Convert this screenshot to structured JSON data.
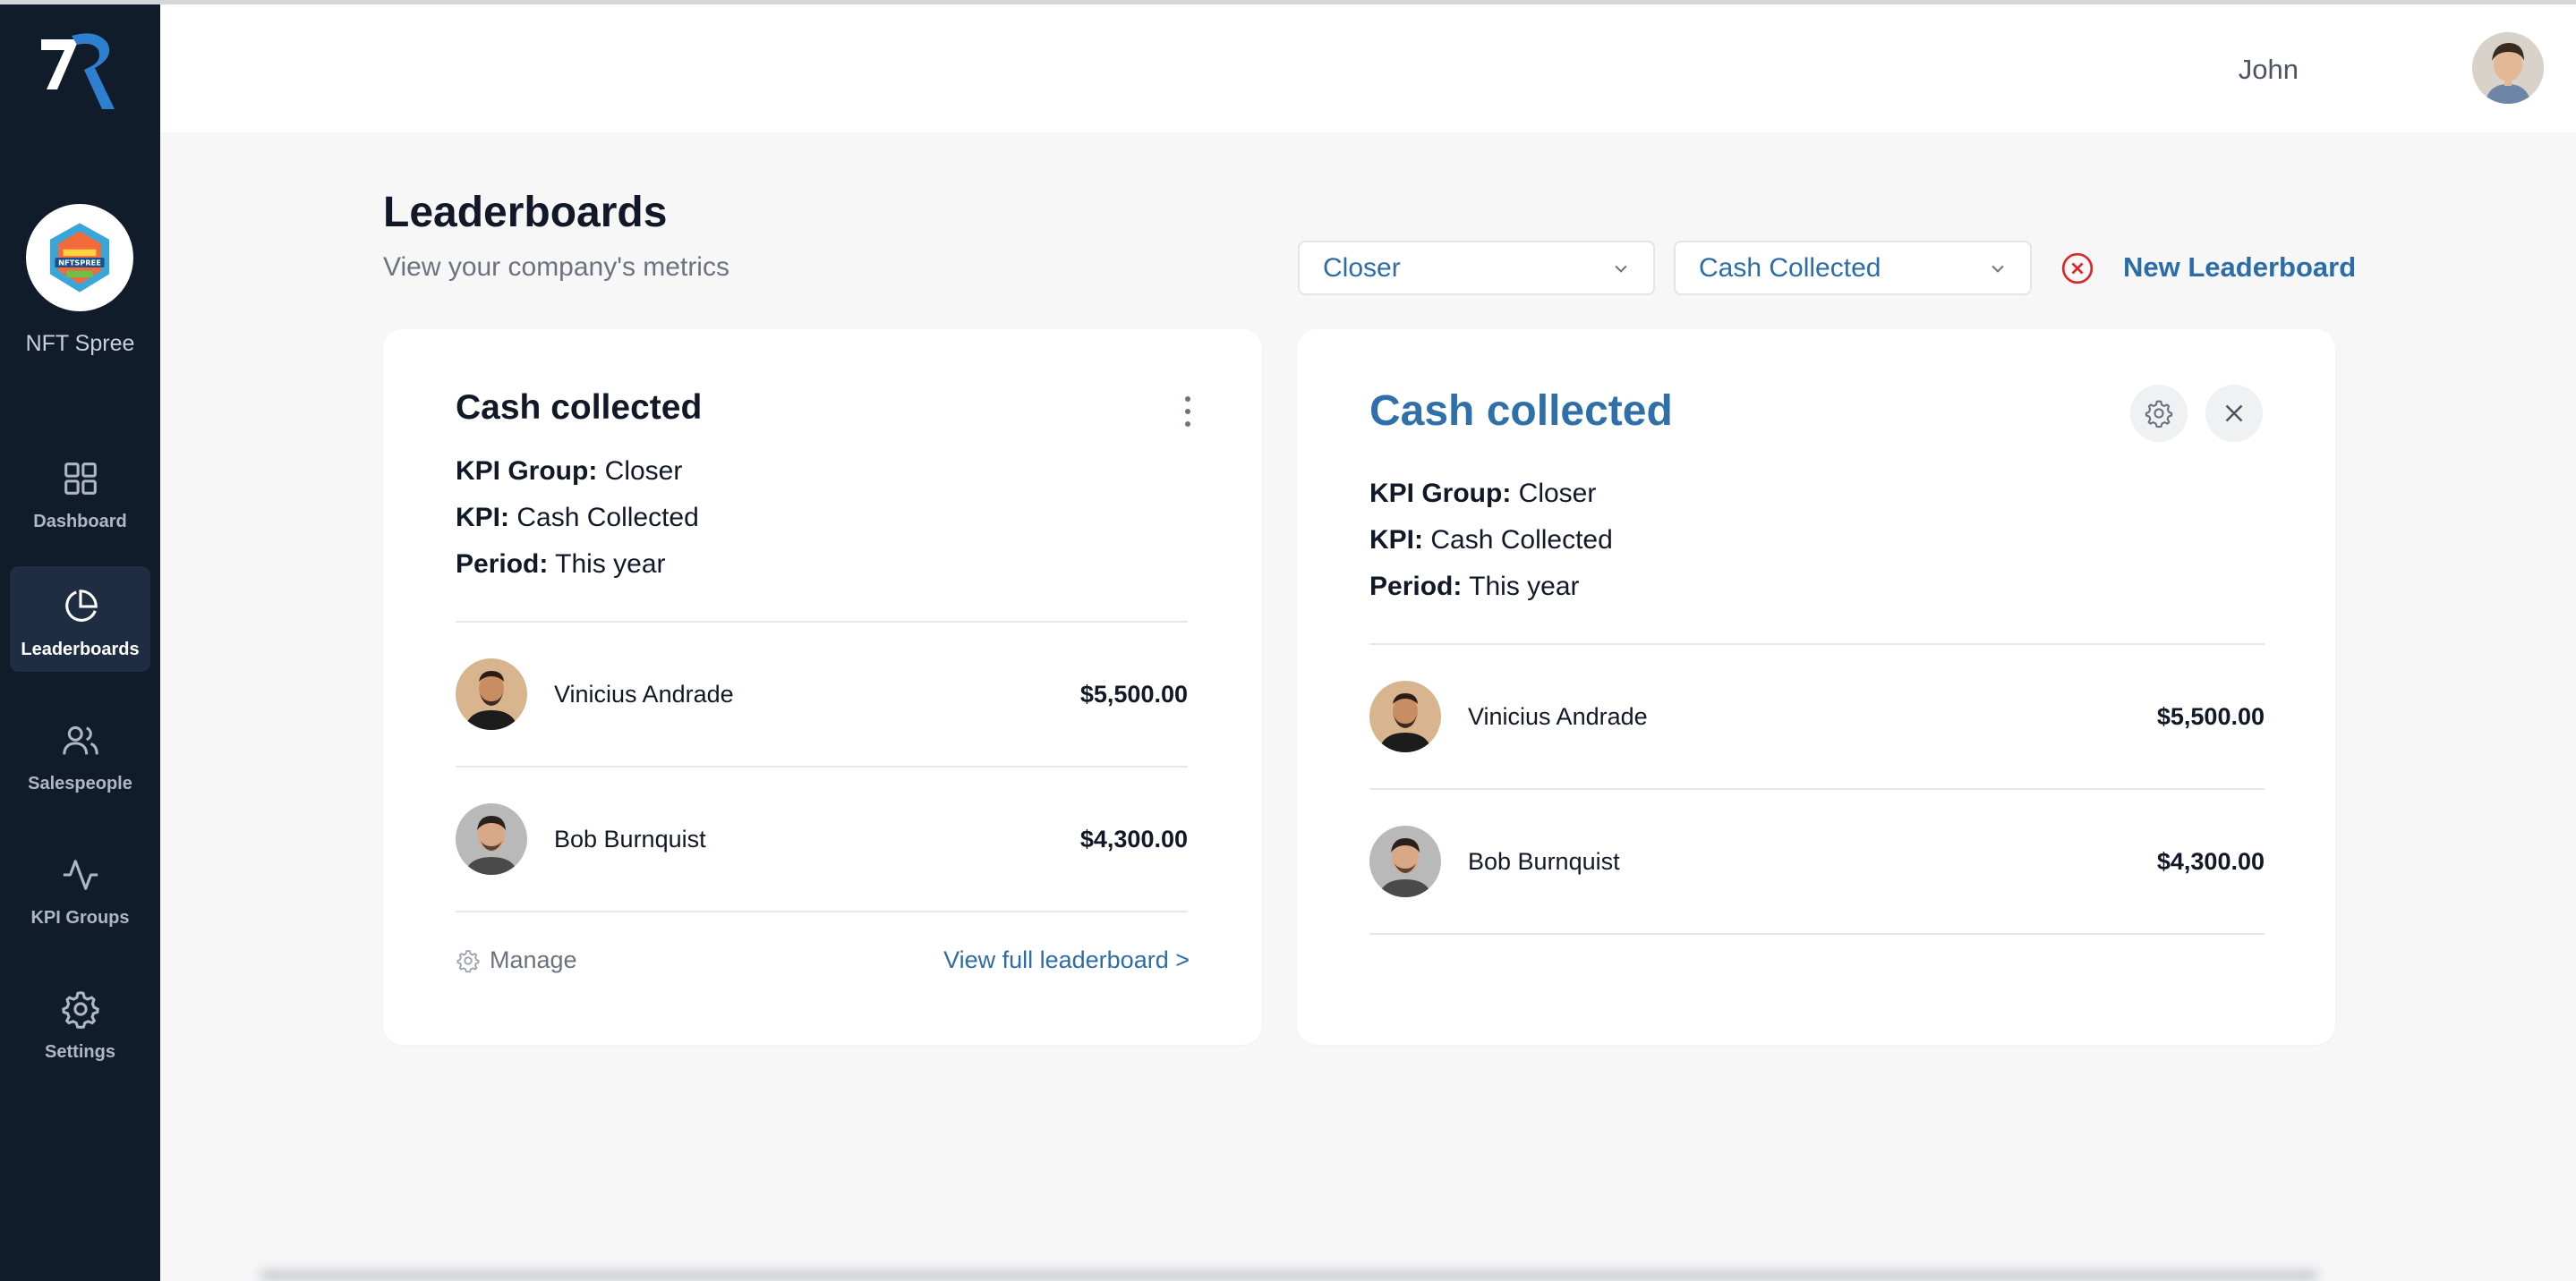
{
  "sidebar": {
    "company_name": "NFT Spree",
    "company_logo_text": "NFTSPREE",
    "items": [
      {
        "label": "Dashboard",
        "icon": "grid-icon"
      },
      {
        "label": "Leaderboards",
        "icon": "pie-chart-icon",
        "active": true
      },
      {
        "label": "Salespeople",
        "icon": "users-icon"
      },
      {
        "label": "KPI Groups",
        "icon": "activity-icon"
      },
      {
        "label": "Settings",
        "icon": "gear-icon"
      }
    ]
  },
  "header": {
    "user_name": "John"
  },
  "page": {
    "title": "Leaderboards",
    "subtitle": "View your company's metrics"
  },
  "filters": {
    "kpi_group": "Closer",
    "kpi": "Cash Collected",
    "new_label": "New Leaderboard"
  },
  "labels": {
    "kpi_group": "KPI Group:",
    "kpi": "KPI:",
    "period": "Period:"
  },
  "cards": [
    {
      "title": "Cash collected",
      "kpi_group": "Closer",
      "kpi": "Cash Collected",
      "period": "This year",
      "rows": [
        {
          "name": "Vinicius Andrade",
          "amount": "$5,500.00"
        },
        {
          "name": "Bob Burnquist",
          "amount": "$4,300.00"
        }
      ],
      "manage_label": "Manage",
      "view_label": "View full leaderboard >"
    },
    {
      "title": "Cash collected",
      "kpi_group": "Closer",
      "kpi": "Cash Collected",
      "period": "This year",
      "rows": [
        {
          "name": "Vinicius Andrade",
          "amount": "$5,500.00"
        },
        {
          "name": "Bob Burnquist",
          "amount": "$4,300.00"
        }
      ]
    }
  ],
  "colors": {
    "sidebar_bg": "#111c2b",
    "accent": "#2c6ca8",
    "danger": "#dc2626"
  }
}
